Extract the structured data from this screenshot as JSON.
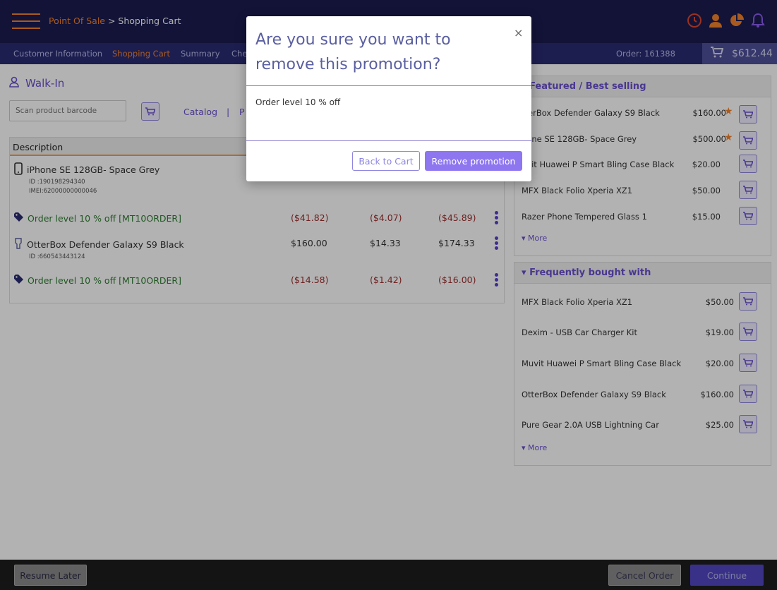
{
  "header": {
    "breadcrumb_root": "Point Of Sale",
    "breadcrumb_sep": " > ",
    "breadcrumb_current": "Shopping Cart",
    "icons": [
      "clock-icon",
      "user-icon",
      "pie-chart-icon",
      "bell-icon"
    ],
    "accent_color": "#f2822c",
    "icon_color": "#e0452c"
  },
  "nav": {
    "tabs": [
      {
        "label": "Customer Information",
        "active": false
      },
      {
        "label": "Shopping Cart",
        "active": true
      },
      {
        "label": "Summary",
        "active": false
      },
      {
        "label": "Che",
        "active": false
      }
    ],
    "order": "Order: 161388",
    "cart_total": "$612.44"
  },
  "customer": {
    "name": "Walk-In"
  },
  "search": {
    "placeholder": "Scan product barcode",
    "catalog": "Catalog",
    "sep": "|",
    "p": "P"
  },
  "cart": {
    "header": "Description",
    "lines": [
      {
        "type": "product",
        "icon": "phone-icon",
        "title": "iPhone SE 128GB- Space Grey",
        "id": "ID :190198294340",
        "imei": "IMEI:62000000000046"
      },
      {
        "type": "promo",
        "icon": "tag-icon",
        "title": "Order level 10 % off [MT10ORDER]",
        "price": "($41.82)",
        "tax": "($4.07)",
        "total": "($45.89)"
      },
      {
        "type": "product",
        "icon": "accessory-icon",
        "title": "OtterBox Defender Galaxy S9 Black",
        "id": "ID :660543443124",
        "price": "$160.00",
        "tax": "$14.33",
        "total": "$174.33"
      },
      {
        "type": "promo",
        "icon": "tag-icon",
        "title": "Order level 10 % off [MT10ORDER]",
        "price": "($14.58)",
        "tax": "($1.42)",
        "total": "($16.00)"
      }
    ]
  },
  "featured": {
    "title": "Featured / Best selling",
    "items": [
      {
        "name": "tterBox Defender Galaxy S9 Black",
        "price": "$160.00",
        "star": true
      },
      {
        "name": "hone SE 128GB- Space Grey",
        "price": "$500.00",
        "star": true
      },
      {
        "name": "uvit Huawei P Smart Bling Case Black",
        "price": "$20.00",
        "star": false
      },
      {
        "name": "MFX Black Folio Xperia XZ1",
        "price": "$50.00",
        "star": false
      },
      {
        "name": "Razer Phone Tempered Glass 1",
        "price": "$15.00",
        "star": false
      }
    ],
    "more": "More"
  },
  "frequent": {
    "title": "Frequently bought with",
    "items": [
      {
        "name": "MFX Black Folio Xperia XZ1",
        "price": "$50.00"
      },
      {
        "name": "Dexim - USB Car Charger Kit",
        "price": "$19.00"
      },
      {
        "name": "Muvit Huawei P Smart Bling Case Black",
        "price": "$20.00"
      },
      {
        "name": "OtterBox Defender Galaxy S9 Black",
        "price": "$160.00"
      },
      {
        "name": "Pure Gear 2.0A USB Lightning Car",
        "price": "$25.00"
      }
    ],
    "more": "More"
  },
  "footer": {
    "resume": "Resume Later",
    "cancel": "Cancel Order",
    "continue": "Continue"
  },
  "modal": {
    "title": "Are you sure you want to remove this promotion?",
    "close": "×",
    "body": "Order level 10 % off",
    "back": "Back to Cart",
    "remove": "Remove promotion"
  }
}
